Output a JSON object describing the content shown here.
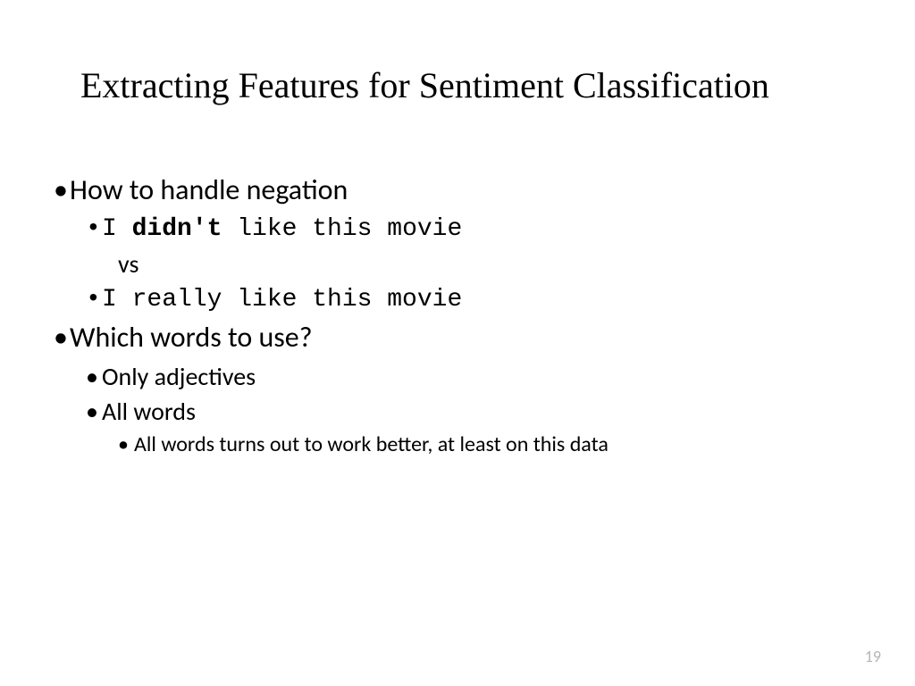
{
  "title": "Extracting Features for Sentiment Classification",
  "bullets": {
    "b1": "How to handle negation",
    "b1_1_pre": "I ",
    "b1_1_bold": "didn't",
    "b1_1_post": " like this movie",
    "vs": "vs",
    "b1_2": "I really like this movie",
    "b2": "Which words to use?",
    "b2_1": "Only adjectives",
    "b2_2": "All words",
    "b2_2_1": "All words turns out to work better, at least on this data"
  },
  "page_number": "19"
}
